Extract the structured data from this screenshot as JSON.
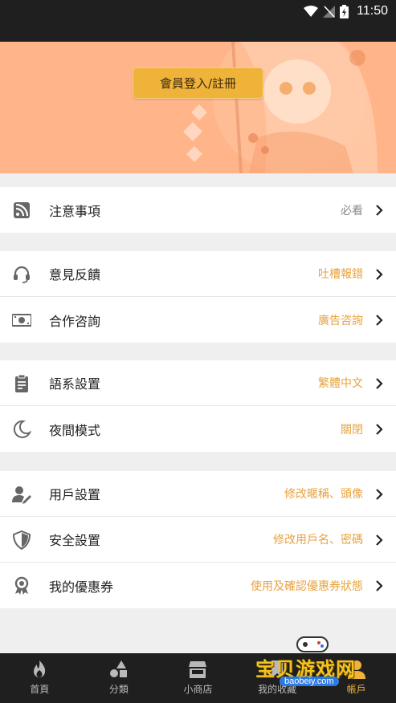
{
  "status_bar": {
    "time": "11:50",
    "icons": [
      "wifi-icon",
      "no-signal-icon",
      "battery-charging-icon"
    ]
  },
  "banner": {
    "login_label": "會員登入/註冊"
  },
  "groups": [
    {
      "items": [
        {
          "icon": "rss-icon",
          "label": "注意事項",
          "value": "必看",
          "value_color": "gray"
        }
      ]
    },
    {
      "items": [
        {
          "icon": "headset-icon",
          "label": "意見反饋",
          "value": "吐槽報錯"
        },
        {
          "icon": "money-icon",
          "label": "合作咨詢",
          "value": "廣告咨詢"
        }
      ]
    },
    {
      "items": [
        {
          "icon": "clipboard-icon",
          "label": "語系設置",
          "value": "繁體中文"
        },
        {
          "icon": "moon-icon",
          "label": "夜間模式",
          "value": "關閉"
        }
      ]
    },
    {
      "items": [
        {
          "icon": "user-edit-icon",
          "label": "用戶設置",
          "value": "修改暱稱、頭像"
        },
        {
          "icon": "shield-icon",
          "label": "安全設置",
          "value": "修改用戶名、密碼"
        },
        {
          "icon": "award-icon",
          "label": "我的優惠券",
          "value": "使用及確認優惠券狀態"
        }
      ]
    }
  ],
  "colors": {
    "accent": "#f0b33a",
    "value_orange": "#e8a23b",
    "value_gray": "#8a8a8a",
    "banner_bg": "#ffb48a",
    "bar_bg": "#1f1f1f"
  },
  "tabs": [
    {
      "icon": "fire-icon",
      "label": "首頁"
    },
    {
      "icon": "shapes-icon",
      "label": "分類"
    },
    {
      "icon": "store-icon",
      "label": "小商店"
    },
    {
      "icon": "bookmark-icon",
      "label": "我的收藏"
    },
    {
      "icon": "user-icon",
      "label": "帳戶",
      "active": true
    }
  ],
  "watermark": {
    "text": "宝贝游戏网",
    "url": "baobeiy.com"
  }
}
